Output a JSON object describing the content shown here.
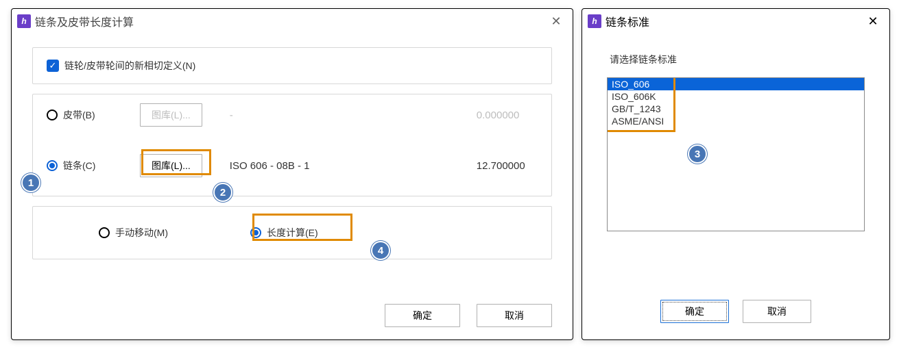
{
  "left_dialog": {
    "title": "链条及皮带长度计算",
    "checkbox_label": "链轮/皮带轮间的新相切定义(N)",
    "belt": {
      "label": "皮带(B)",
      "library_btn": "图库(L)...",
      "spec": "-",
      "value": "0.000000"
    },
    "chain": {
      "label": "链条(C)",
      "library_btn": "图库(L)...",
      "spec": "ISO 606 - 08B - 1",
      "value": "12.700000"
    },
    "mode": {
      "manual": "手动移动(M)",
      "calc": "长度计算(E)"
    },
    "ok": "确定",
    "cancel": "取消"
  },
  "right_dialog": {
    "title": "链条标准",
    "prompt": "请选择链条标准",
    "items": [
      "ISO_606",
      "ISO_606K",
      "GB/T_1243",
      "ASME/ANSI"
    ],
    "ok": "确定",
    "cancel": "取消"
  },
  "badges": {
    "b1": "1",
    "b2": "2",
    "b3": "3",
    "b4": "4"
  }
}
